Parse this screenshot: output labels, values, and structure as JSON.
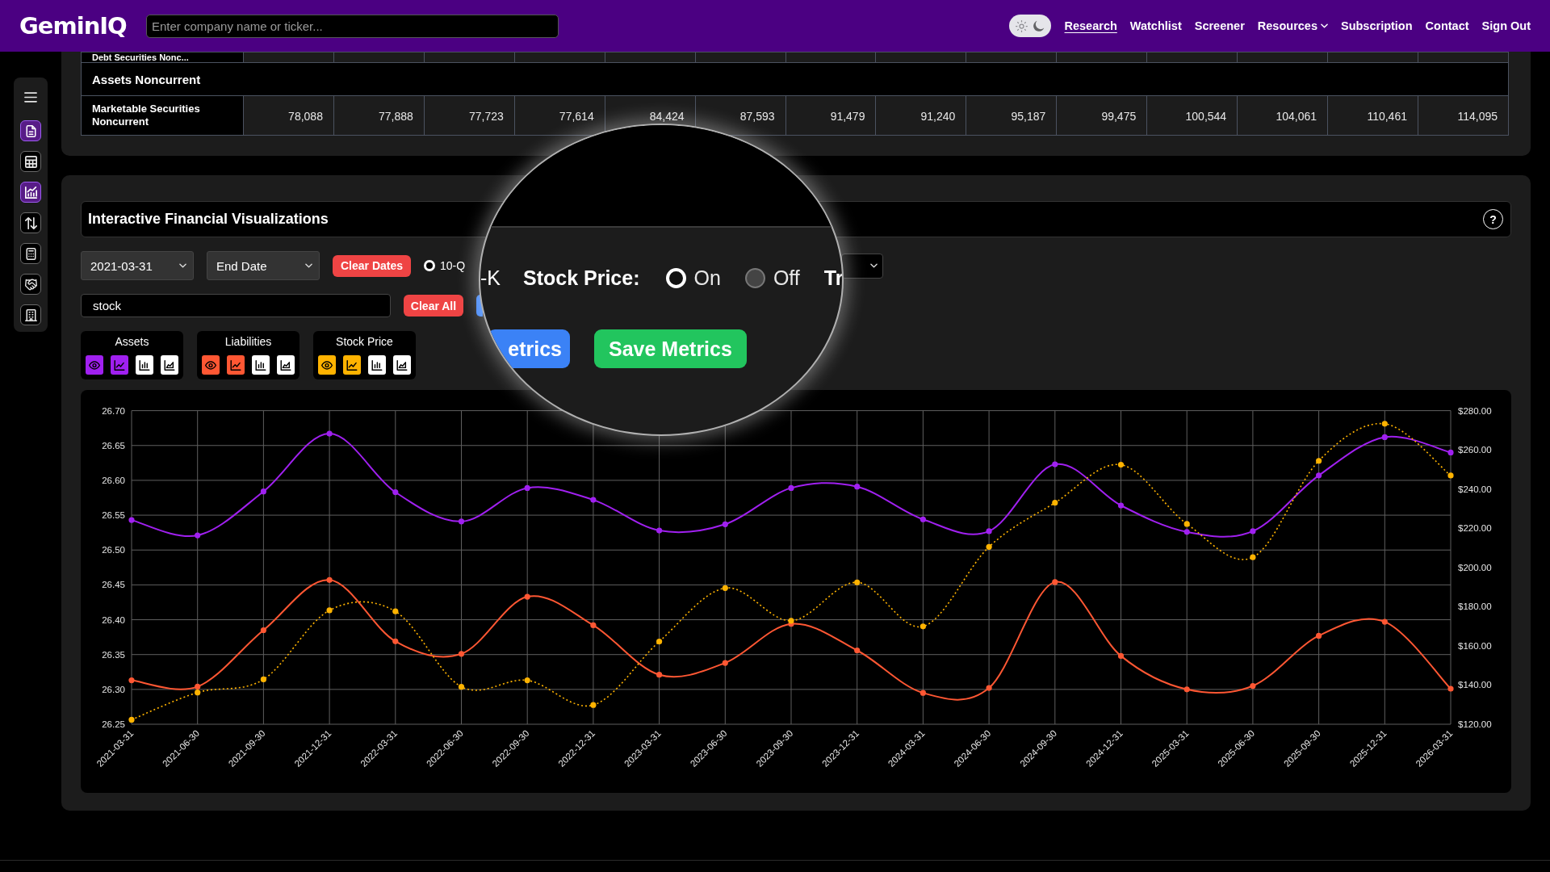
{
  "header": {
    "brand": "GeminIQ",
    "search": {
      "placeholder": "Enter company name or ticker..."
    },
    "theme_toggle": {
      "dark": true
    },
    "nav": [
      {
        "label": "Research",
        "selected": true,
        "kind": "link"
      },
      {
        "label": "Watchlist",
        "selected": false,
        "kind": "link"
      },
      {
        "label": "Screener",
        "selected": false,
        "kind": "link"
      },
      {
        "label": "Resources",
        "selected": false,
        "kind": "menu"
      },
      {
        "label": "Subscription",
        "selected": false,
        "kind": "link"
      },
      {
        "label": "Contact",
        "selected": false,
        "kind": "link"
      },
      {
        "label": "Sign Out",
        "selected": false,
        "kind": "link"
      }
    ]
  },
  "sidebar": {
    "items": [
      {
        "kind": "menu",
        "selected": false
      },
      {
        "kind": "document",
        "selected": true
      },
      {
        "kind": "table",
        "selected": false
      },
      {
        "kind": "chart",
        "selected": true
      },
      {
        "kind": "transfer",
        "selected": false
      },
      {
        "kind": "calculator",
        "selected": false
      },
      {
        "kind": "handshake",
        "selected": false
      },
      {
        "kind": "building",
        "selected": false
      }
    ]
  },
  "financial_table": {
    "rows": [
      {
        "kind": "data",
        "label": "Debt Securities Nonc..."
      },
      {
        "kind": "section",
        "label": "Assets Noncurrent"
      },
      {
        "kind": "data",
        "label": "Marketable Securities Noncurrent",
        "values": [
          "78,088",
          "77,888",
          "77,723",
          "77,614",
          "84,424",
          "87,593",
          "91,479",
          "91,240",
          "95,187",
          "99,475",
          "100,544",
          "104,061",
          "110,461",
          "114,095"
        ]
      }
    ]
  },
  "visualizations": {
    "title": "Interactive Financial Visualizations",
    "help": "?",
    "start_date": {
      "value": "2021-03-31"
    },
    "end_date": {
      "placeholder": "End Date"
    },
    "clear_dates": "Clear Dates",
    "filing_types": [
      {
        "label": "10-Q",
        "selected": true
      }
    ],
    "metric_search": {
      "value": "stock"
    },
    "clear_all": "Clear All",
    "metric_groups": [
      {
        "name": "Assets",
        "color": "#a020f0",
        "toggles": [
          {
            "kind": "visibility",
            "on": true
          },
          {
            "kind": "line",
            "on": true
          },
          {
            "kind": "bar",
            "on": false
          },
          {
            "kind": "area",
            "on": false
          }
        ]
      },
      {
        "name": "Liabilities",
        "color": "#ff5733",
        "toggles": [
          {
            "kind": "visibility",
            "on": true
          },
          {
            "kind": "line",
            "on": true
          },
          {
            "kind": "bar",
            "on": false
          },
          {
            "kind": "area",
            "on": false
          }
        ]
      },
      {
        "name": "Stock Price",
        "color": "#ffb300",
        "toggles": [
          {
            "kind": "visibility",
            "on": true
          },
          {
            "kind": "line",
            "on": true
          },
          {
            "kind": "bar",
            "on": false
          },
          {
            "kind": "area",
            "on": false
          }
        ]
      }
    ],
    "chart_data": {
      "type": "line",
      "grid": true,
      "categories": [
        "2021-03-31",
        "2021-06-30",
        "2021-09-30",
        "2021-12-31",
        "2022-03-31",
        "2022-06-30",
        "2022-09-30",
        "2022-12-31",
        "2023-03-31",
        "2023-06-30",
        "2023-09-30",
        "2023-12-31",
        "2024-03-31",
        "2024-06-30",
        "2024-09-30",
        "2024-12-31",
        "2025-03-31",
        "2025-06-30",
        "2025-09-30",
        "2025-12-31",
        "2026-03-31"
      ],
      "ylim": [
        26.25,
        26.7
      ],
      "yticks": [
        {
          "value": 26.25,
          "label": "26.25"
        },
        {
          "value": 26.3,
          "label": "26.30"
        },
        {
          "value": 26.35,
          "label": "26.35"
        },
        {
          "value": 26.4,
          "label": "26.40"
        },
        {
          "value": 26.45,
          "label": "26.45"
        },
        {
          "value": 26.5,
          "label": "26.50"
        },
        {
          "value": 26.55,
          "label": "26.55"
        },
        {
          "value": 26.6,
          "label": "26.60"
        },
        {
          "value": 26.65,
          "label": "26.65"
        },
        {
          "value": 26.7,
          "label": "26.70"
        }
      ],
      "y2lim": [
        120,
        280
      ],
      "y2ticks": [
        {
          "value": 120,
          "label": "$120.00"
        },
        {
          "value": 140,
          "label": "$140.00"
        },
        {
          "value": 160,
          "label": "$160.00"
        },
        {
          "value": 180,
          "label": "$180.00"
        },
        {
          "value": 200,
          "label": "$200.00"
        },
        {
          "value": 220,
          "label": "$220.00"
        },
        {
          "value": 240,
          "label": "$240.00"
        },
        {
          "value": 260,
          "label": "$260.00"
        },
        {
          "value": 280,
          "label": "$280.00"
        }
      ],
      "series": [
        {
          "color": "#a020f0",
          "line_style": "solid",
          "marker": "circle",
          "values": [
            26.543,
            26.521,
            26.584,
            26.667,
            26.583,
            26.541,
            26.589,
            26.572,
            26.528,
            26.537,
            26.589,
            26.591,
            26.544,
            26.527,
            26.623,
            26.564,
            26.526,
            26.527,
            26.607,
            26.662,
            26.64
          ]
        },
        {
          "color": "#ff5733",
          "line_style": "solid",
          "marker": "circle",
          "values": [
            26.313,
            26.304,
            26.385,
            26.457,
            26.369,
            26.351,
            26.433,
            26.392,
            26.321,
            26.338,
            26.394,
            26.356,
            26.295,
            26.302,
            26.454,
            26.348,
            26.3,
            26.305,
            26.377,
            26.397,
            26.301
          ]
        },
        {
          "color": "#ffb300",
          "axis": "y2",
          "line_style": "dotted",
          "marker": "circle",
          "values": [
            122.3,
            136.2,
            142.9,
            178.1,
            177.6,
            139.1,
            142.4,
            129.8,
            162.2,
            189.5,
            172.8,
            192.4,
            169.9,
            210.5,
            233.0,
            252.4,
            222.2,
            205.2,
            254.4,
            273.3,
            246.9
          ]
        }
      ]
    }
  },
  "magnifier": {
    "filing_fragment": "-K",
    "stock_price": {
      "label": "Stock Price:",
      "options": [
        {
          "label": "On",
          "selected": true
        },
        {
          "label": "Off",
          "selected": false
        }
      ]
    },
    "next_fragment": "Tr",
    "buttons": [
      {
        "label": "etrics",
        "kind": "primary"
      },
      {
        "label": "Save Metrics",
        "kind": "save"
      }
    ]
  }
}
